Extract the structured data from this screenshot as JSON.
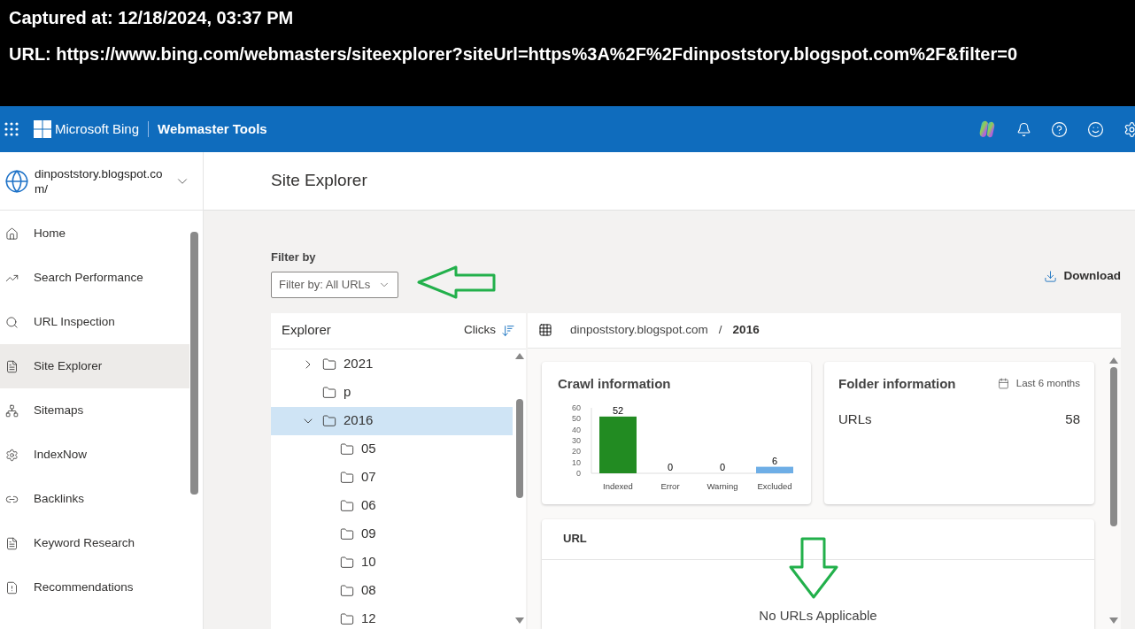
{
  "capture": {
    "captured_at": "Captured at: 12/18/2024, 03:37 PM",
    "url": "URL: https://www.bing.com/webmasters/siteexplorer?siteUrl=https%3A%2F%2Fdinpoststory.blogspot.com%2F&filter=0"
  },
  "topbar": {
    "brand": "Microsoft Bing",
    "product": "Webmaster Tools"
  },
  "site_picker": {
    "value": "dinpoststory.blogspot.com/"
  },
  "sidebar": {
    "items": [
      {
        "label": "Home",
        "selected": false
      },
      {
        "label": "Search Performance",
        "selected": false
      },
      {
        "label": "URL Inspection",
        "selected": false
      },
      {
        "label": "Site Explorer",
        "selected": true
      },
      {
        "label": "Sitemaps",
        "selected": false
      },
      {
        "label": "IndexNow",
        "selected": false
      },
      {
        "label": "Backlinks",
        "selected": false
      },
      {
        "label": "Keyword Research",
        "selected": false
      },
      {
        "label": "Recommendations",
        "selected": false
      }
    ]
  },
  "page_title": "Site Explorer",
  "filter": {
    "label": "Filter by",
    "value": "Filter by: All URLs"
  },
  "download": "Download",
  "explorer": {
    "title": "Explorer",
    "sort_label": "Clicks",
    "tree": [
      {
        "label": "2021",
        "kind": "expandable",
        "expanded": false,
        "selected": false
      },
      {
        "label": "p",
        "kind": "leaf",
        "selected": false
      },
      {
        "label": "2016",
        "kind": "expandable",
        "expanded": true,
        "selected": true,
        "children": [
          {
            "label": "05",
            "kind": "leaf",
            "selected": false
          },
          {
            "label": "07",
            "kind": "leaf",
            "selected": false
          },
          {
            "label": "06",
            "kind": "leaf",
            "selected": false
          },
          {
            "label": "09",
            "kind": "leaf",
            "selected": false
          },
          {
            "label": "10",
            "kind": "leaf",
            "selected": false
          },
          {
            "label": "08",
            "kind": "leaf",
            "selected": false
          },
          {
            "label": "12",
            "kind": "leaf",
            "selected": false
          }
        ]
      }
    ]
  },
  "breadcrumb": {
    "site": "dinpoststory.blogspot.com",
    "separator": "/",
    "folder": "2016"
  },
  "crawl": {
    "title": "Crawl information",
    "chart_data": {
      "type": "bar",
      "categories": [
        "Indexed",
        "Error",
        "Warning",
        "Excluded"
      ],
      "series": [
        {
          "colors": [
            "#228b22",
            "#228b22",
            "#228b22",
            "#6eaee6"
          ],
          "values": [
            52,
            0,
            0,
            6
          ]
        }
      ],
      "ylim": [
        0,
        60
      ],
      "yticks": [
        0,
        10,
        20,
        30,
        40,
        50,
        60
      ],
      "data_labels": true
    }
  },
  "folder": {
    "title": "Folder information",
    "period": "Last 6 months",
    "rows": [
      {
        "label": "URLs",
        "value": "58"
      }
    ]
  },
  "url_table": {
    "column": "URL",
    "empty": "No URLs Applicable"
  }
}
